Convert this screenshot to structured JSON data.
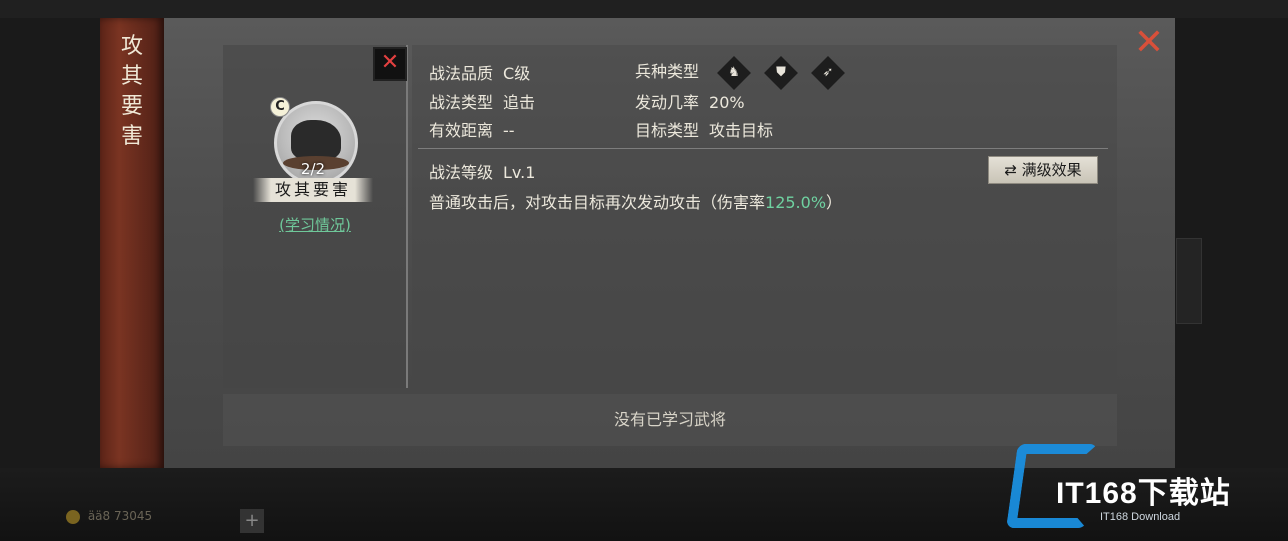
{
  "background": {
    "resource_text": "ää8 73045"
  },
  "modal": {
    "title": "攻其要害",
    "close_icon": "close-icon"
  },
  "skill_card": {
    "grade": "C",
    "count": "2/2",
    "name": "攻其要害",
    "learn_link": "(学习情况)"
  },
  "info": {
    "quality_label": "战法品质",
    "quality_value": "C级",
    "type_label": "战法类型",
    "type_value": "追击",
    "range_label": "有效距离",
    "range_value": "--",
    "troop_label": "兵种类型",
    "troop_icons": [
      "cavalry-icon",
      "shield-icon",
      "archer-icon"
    ],
    "trigger_label": "发动几率",
    "trigger_value": "20%",
    "target_label": "目标类型",
    "target_value": "攻击目标",
    "level_label": "战法等级",
    "level_value": "Lv.1",
    "max_level_button": "满级效果",
    "desc_prefix": "普通攻击后，对攻击目标再次发动攻击（伤害率",
    "desc_rate": "125.0%",
    "desc_suffix": "）",
    "highlight_color": "#6fd1a0"
  },
  "bottom": {
    "message": "没有已学习武将"
  },
  "watermark": {
    "brand": "IT168下载站",
    "sub": "IT168 Download"
  }
}
